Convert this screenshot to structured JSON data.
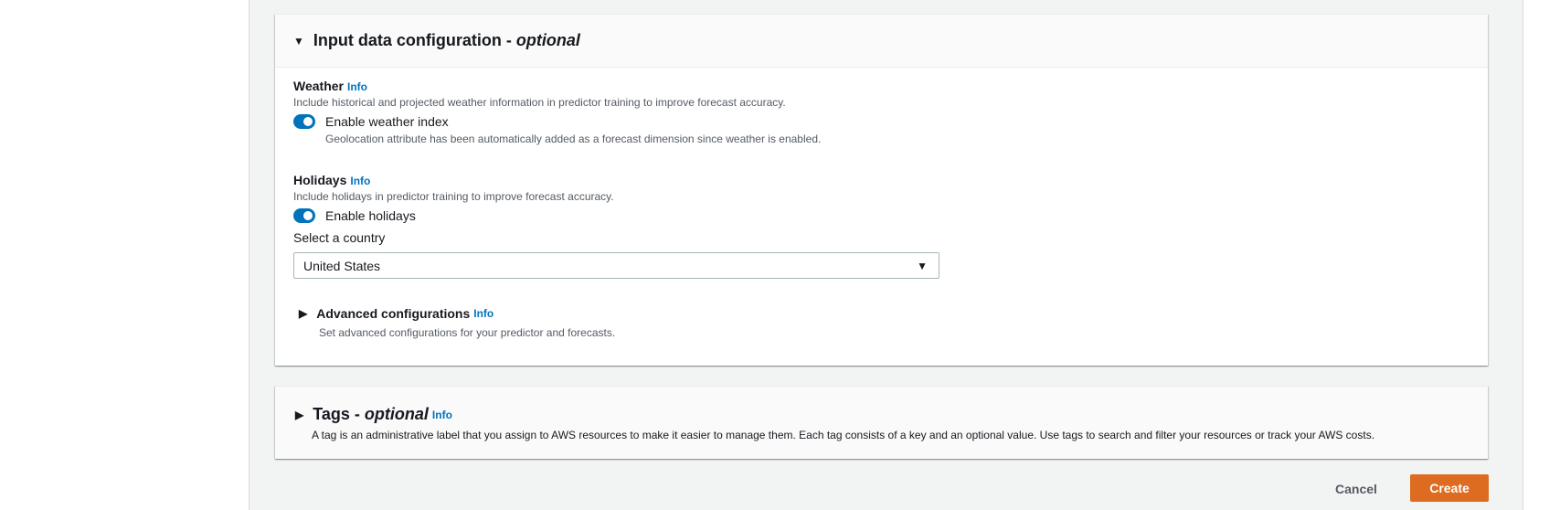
{
  "input_config": {
    "title": "Input data configuration - ",
    "title_optional": "optional",
    "weather": {
      "heading": "Weather",
      "info": "Info",
      "description": "Include historical and projected weather information in predictor training to improve forecast accuracy.",
      "toggle_label": "Enable weather index",
      "toggle_on": true,
      "note": "Geolocation attribute has been automatically added as a forecast dimension since weather is enabled."
    },
    "holidays": {
      "heading": "Holidays",
      "info": "Info",
      "description": "Include holidays in predictor training to improve forecast accuracy.",
      "toggle_label": "Enable holidays",
      "toggle_on": true,
      "country_label": "Select a country",
      "country_value": "United States"
    },
    "advanced": {
      "title": "Advanced configurations",
      "info": "Info",
      "description": "Set advanced configurations for your predictor and forecasts."
    }
  },
  "tags": {
    "title": "Tags - ",
    "title_optional": "optional",
    "info": "Info",
    "description": "A tag is an administrative label that you assign to AWS resources to make it easier to manage them. Each tag consists of a key and an optional value. Use tags to search and filter your resources or track your AWS costs."
  },
  "actions": {
    "cancel": "Cancel",
    "create": "Create"
  },
  "colors": {
    "accent": "#0073bb",
    "primary_button": "#dd6b20"
  }
}
